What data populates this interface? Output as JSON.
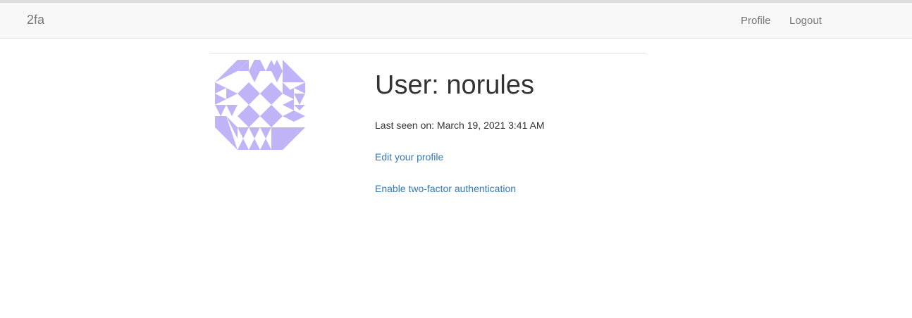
{
  "navbar": {
    "brand": "2fa",
    "links": [
      "Profile",
      "Logout"
    ]
  },
  "profile": {
    "title": "User: norules",
    "last_seen": "Last seen on: March 19, 2021 3:41 AM",
    "edit_link": "Edit your profile",
    "enable_2fa_link": "Enable two-factor authentication"
  },
  "colors": {
    "avatar": "#c1b3f8",
    "link": "#337ab7"
  }
}
